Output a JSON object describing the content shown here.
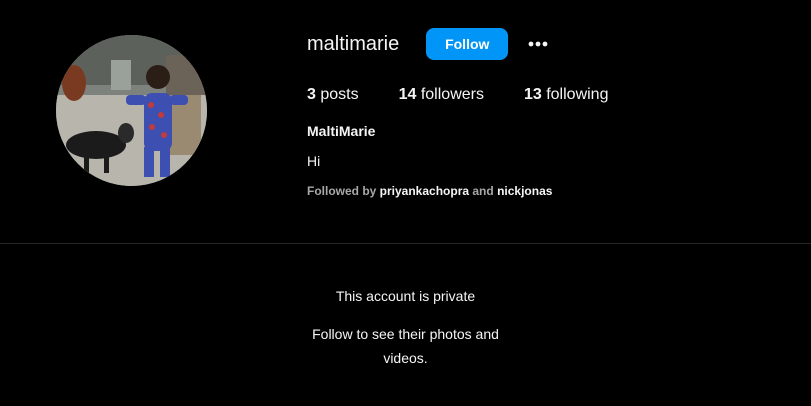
{
  "profile": {
    "username": "maltimarie",
    "full_name": "MaltiMarie",
    "bio": "Hi",
    "follow_label": "Follow",
    "more_icon": "more-horizontal-icon",
    "posts_count": "3",
    "posts_label": " posts",
    "followers_count": "14",
    "followers_label": " followers",
    "following_count": "13",
    "following_label": " following",
    "followed_by_prefix": "Followed by ",
    "followed_by_user1": "priyankachopra",
    "followed_by_and": " and ",
    "followed_by_user2": "nickjonas"
  },
  "private_notice": {
    "title": "This account is private",
    "subtitle": "Follow to see their photos and videos."
  },
  "colors": {
    "background": "#000000",
    "accent": "#0095f6",
    "text": "#f5f5f5",
    "secondary_text": "#a8a8a8",
    "divider": "#262626"
  }
}
